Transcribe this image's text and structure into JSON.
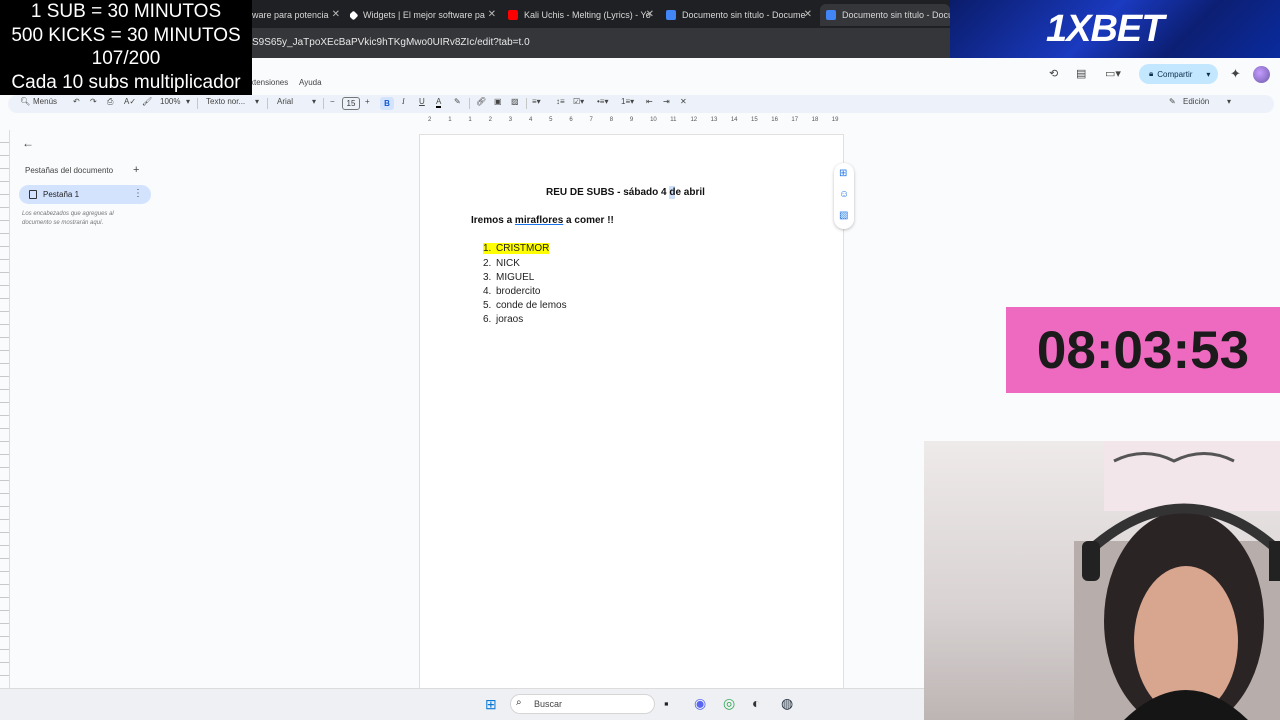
{
  "browser": {
    "tabs": [
      {
        "label": "ware para potencia"
      },
      {
        "label": "Widgets | El mejor software pa"
      },
      {
        "label": "Kali Uchis - Melting (Lyrics) - Yo"
      },
      {
        "label": "Documento sin título - Docume"
      },
      {
        "label": "Documento sin título - Docum"
      }
    ],
    "url": "S9S65y_JaTpoXEcBaPVkic9hTKgMwo0UIRv8ZIc/edit?tab=t.0"
  },
  "docs": {
    "menus": [
      "xtensiones",
      "Ayuda"
    ],
    "share_label": "Compartir",
    "toolbar": {
      "menus_label": "Menús",
      "zoom": "100%",
      "style": "Texto nor...",
      "font": "Arial",
      "font_size": "15",
      "bold": "B",
      "italic": "I",
      "underline": "U",
      "text_color": "A",
      "mode": "Edición"
    },
    "ruler_marks": [
      "2",
      "1",
      "1",
      "2",
      "3",
      "4",
      "5",
      "6",
      "7",
      "8",
      "9",
      "10",
      "11",
      "12",
      "13",
      "14",
      "15",
      "16",
      "17",
      "18",
      "19"
    ],
    "side_panel": {
      "title": "Pestañas del documento",
      "tab_label": "Pestaña 1",
      "hint": "Los encabezados que agregues al documento se mostrarán aquí."
    },
    "content": {
      "title": "REU DE SUBS - sábado 4 de abril",
      "subtitle_pre": "Iremos a ",
      "subtitle_link": "miraflores",
      "subtitle_post": " a comer !!",
      "list": [
        {
          "n": "1.",
          "text": "CRISTMOR",
          "highlight": true
        },
        {
          "n": "2.",
          "text": "NICK"
        },
        {
          "n": "3.",
          "text": "MIGUEL"
        },
        {
          "n": "4.",
          "text": "brodercito"
        },
        {
          "n": "5.",
          "text": "conde de lemos"
        },
        {
          "n": "6.",
          "text": "joraos"
        }
      ]
    }
  },
  "overlay": {
    "line1": "1 SUB      = 30 MINUTOS",
    "line2": "500 KICKS = 30 MINUTOS",
    "line3": "107/200",
    "line4": "Cada 10 subs multiplicador",
    "brand": "1XBET",
    "timer": "08:03:53",
    "timer_color": "#ee6ac0"
  },
  "taskbar": {
    "search_label": "Buscar"
  }
}
